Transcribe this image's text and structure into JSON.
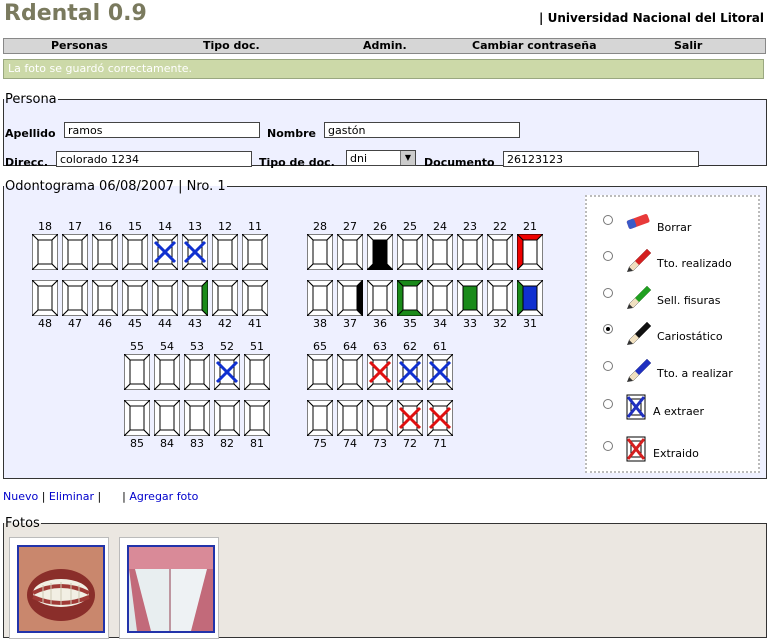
{
  "app": {
    "title": "Rdental 0.9",
    "university": "| Universidad Nacional del Litoral"
  },
  "menu": [
    "Personas",
    "Tipo doc.",
    "Admin.",
    "Cambiar contraseña",
    "Salir"
  ],
  "message": "La foto se guardó correctamente.",
  "persona": {
    "legend": "Persona",
    "apellido_label": "Apellido",
    "apellido": "ramos",
    "nombre_label": "Nombre",
    "nombre": "gastón",
    "direcc_label": "Direcc.",
    "direcc": "colorado 1234",
    "tipo_doc_label": "Tipo de doc.",
    "tipo_doc": "dni",
    "documento_label": "Documento",
    "documento": "26123123"
  },
  "odontograma": {
    "legend": "Odontograma 06/08/2007 | Nro. 1",
    "rows": [
      {
        "id": "upper-right",
        "teeth": [
          {
            "n": "18",
            "mark": ""
          },
          {
            "n": "17",
            "mark": ""
          },
          {
            "n": "16",
            "mark": ""
          },
          {
            "n": "15",
            "mark": ""
          },
          {
            "n": "14",
            "mark": "x-blue"
          },
          {
            "n": "13",
            "mark": "x-blue"
          },
          {
            "n": "12",
            "mark": ""
          },
          {
            "n": "11",
            "mark": ""
          }
        ]
      },
      {
        "id": "upper-left",
        "teeth": [
          {
            "n": "28",
            "mark": ""
          },
          {
            "n": "27",
            "mark": ""
          },
          {
            "n": "26",
            "mark": "black-bottom"
          },
          {
            "n": "25",
            "mark": ""
          },
          {
            "n": "24",
            "mark": ""
          },
          {
            "n": "23",
            "mark": ""
          },
          {
            "n": "22",
            "mark": ""
          },
          {
            "n": "21",
            "mark": "red-top-left"
          }
        ]
      },
      {
        "id": "lower-right",
        "teeth": [
          {
            "n": "48",
            "mark": ""
          },
          {
            "n": "47",
            "mark": ""
          },
          {
            "n": "46",
            "mark": ""
          },
          {
            "n": "45",
            "mark": ""
          },
          {
            "n": "44",
            "mark": ""
          },
          {
            "n": "43",
            "mark": "green-right"
          },
          {
            "n": "42",
            "mark": ""
          },
          {
            "n": "41",
            "mark": ""
          }
        ]
      },
      {
        "id": "lower-left",
        "teeth": [
          {
            "n": "38",
            "mark": ""
          },
          {
            "n": "37",
            "mark": "black-right"
          },
          {
            "n": "36",
            "mark": ""
          },
          {
            "n": "35",
            "mark": "green-u"
          },
          {
            "n": "34",
            "mark": ""
          },
          {
            "n": "33",
            "mark": "green-center"
          },
          {
            "n": "32",
            "mark": ""
          },
          {
            "n": "31",
            "mark": "blue-center-green-left"
          }
        ]
      },
      {
        "id": "child-upper-right",
        "teeth": [
          {
            "n": "55",
            "mark": ""
          },
          {
            "n": "54",
            "mark": ""
          },
          {
            "n": "53",
            "mark": ""
          },
          {
            "n": "52",
            "mark": "x-blue"
          },
          {
            "n": "51",
            "mark": ""
          }
        ]
      },
      {
        "id": "child-upper-left",
        "teeth": [
          {
            "n": "65",
            "mark": ""
          },
          {
            "n": "64",
            "mark": ""
          },
          {
            "n": "63",
            "mark": "x-red"
          },
          {
            "n": "62",
            "mark": "x-blue"
          },
          {
            "n": "61",
            "mark": "x-blue"
          }
        ]
      },
      {
        "id": "child-lower-right",
        "teeth": [
          {
            "n": "85",
            "mark": ""
          },
          {
            "n": "84",
            "mark": ""
          },
          {
            "n": "83",
            "mark": ""
          },
          {
            "n": "82",
            "mark": ""
          },
          {
            "n": "81",
            "mark": ""
          }
        ]
      },
      {
        "id": "child-lower-left",
        "teeth": [
          {
            "n": "75",
            "mark": ""
          },
          {
            "n": "74",
            "mark": ""
          },
          {
            "n": "73",
            "mark": ""
          },
          {
            "n": "72",
            "mark": "x-red"
          },
          {
            "n": "71",
            "mark": "x-red"
          }
        ]
      }
    ],
    "tools": [
      {
        "label": "Borrar",
        "icon": "eraser-icon",
        "color": "#e83a3a",
        "selected": false
      },
      {
        "label": "Tto. realizado",
        "icon": "pencil-red-icon",
        "color": "#d42020",
        "selected": false
      },
      {
        "label": "Sell. fisuras",
        "icon": "pencil-green-icon",
        "color": "#20a020",
        "selected": false
      },
      {
        "label": "Cariostático",
        "icon": "pencil-black-icon",
        "color": "#111111",
        "selected": true
      },
      {
        "label": "Tto. a realizar",
        "icon": "pencil-blue-icon",
        "color": "#2030c0",
        "selected": false
      },
      {
        "label": "A extraer",
        "icon": "tooth-x-blue-icon",
        "color": "#2030c0",
        "selected": false
      },
      {
        "label": "Extraido",
        "icon": "tooth-x-red-icon",
        "color": "#d42020",
        "selected": false
      }
    ]
  },
  "links": {
    "nuevo": "Nuevo",
    "eliminar": "Eliminar",
    "agregar_foto": "Agregar foto"
  },
  "fotos": {
    "legend": "Fotos"
  }
}
